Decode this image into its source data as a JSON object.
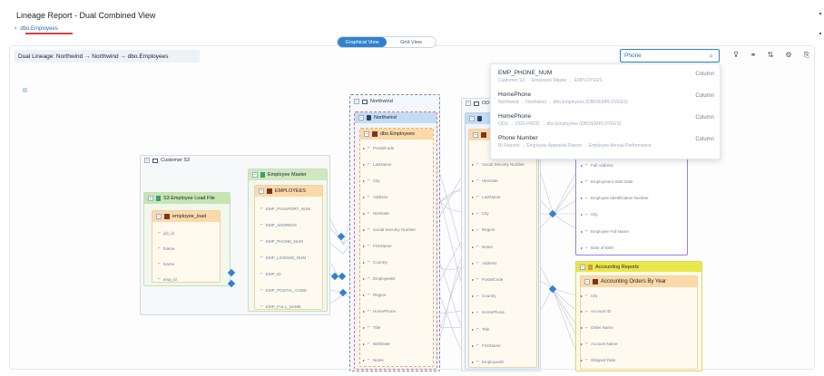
{
  "window": {
    "title": "Lineage Report - Dual Combined View"
  },
  "tabs": [
    {
      "label": "dbo.Employees"
    }
  ],
  "view_toggle": {
    "graphical": "Graphical View",
    "grid": "Grid View"
  },
  "lineage": {
    "title": "Dual Lineage: Northwind → Northwind → dbo.Employees"
  },
  "search": {
    "value": "Phone",
    "results": [
      {
        "name": "EMP_PHONE_NUM",
        "path": "Customer S3 → Employee Master → EMPLOYEES",
        "type": "Column"
      },
      {
        "name": "HomePhone",
        "path": "Northwind → Northwind → dbo.Employees (DBO/EMPLOYEES)",
        "type": "Column"
      },
      {
        "name": "HomePhone",
        "path": "ODS → ODS-PROD → dbo.Employees (DBO/EMPLOYEES)",
        "type": "Column"
      },
      {
        "name": "Phone Number",
        "path": "BI Reports → Employee Appraisal Report → Employee Annual Performance",
        "type": "Column"
      }
    ]
  },
  "toolbar": {
    "icons": [
      "filter-icon",
      "link-icon",
      "sort-icon",
      "settings-icon",
      "export-icon"
    ]
  },
  "graph": {
    "customer_s3": {
      "label": "Customer S3"
    },
    "load_file": {
      "label": "S3 Employee Load File",
      "table": "employee_load",
      "fields": [
        "job_id",
        "fname",
        "lname",
        "emp_id"
      ]
    },
    "emp_master": {
      "label": "Employee Master",
      "table": "EMPLOYEES",
      "fields": [
        "EMP_PASSPORT_NUM",
        "EMP_ADDRESS",
        "EMP_PHONE_NUM",
        "EMP_LICENSE_NUM",
        "EMP_ID",
        "EMP_POSTAL_CODE",
        "EMP_FULL_NAME"
      ]
    },
    "northwind_outer": {
      "label": "Northwind"
    },
    "northwind_inner": {
      "label": "Northwind"
    },
    "nw_employees": {
      "label": "dbo.Employees",
      "fields": [
        "PostalCode",
        "LastName",
        "City",
        "Address",
        "HireDate",
        "Social Security Number",
        "FirstName",
        "Country",
        "EmployeeID",
        "Region",
        "HomePhone",
        "Title",
        "BirthDate",
        "Notes"
      ]
    },
    "ods": {
      "label": "ODS",
      "fields": [
        "Social Security Number",
        "HireDate",
        "LastName",
        "City",
        "Region",
        "Notes",
        "Address",
        "PostalCode",
        "Country",
        "HomePhone",
        "Title",
        "FirstName",
        "EmployeeID"
      ]
    },
    "right_top": {
      "fields": [
        "Full Address",
        "Employment Start Date",
        "Employee Identification Number",
        "City",
        "Employee Full Name",
        "Date of Birth"
      ]
    },
    "accounting": {
      "label": "Accounting Reports",
      "table": "Accounting Orders By Year",
      "fields": [
        "City",
        "Account ID",
        "Order Name",
        "Account Name",
        "Shipped Date"
      ]
    }
  }
}
